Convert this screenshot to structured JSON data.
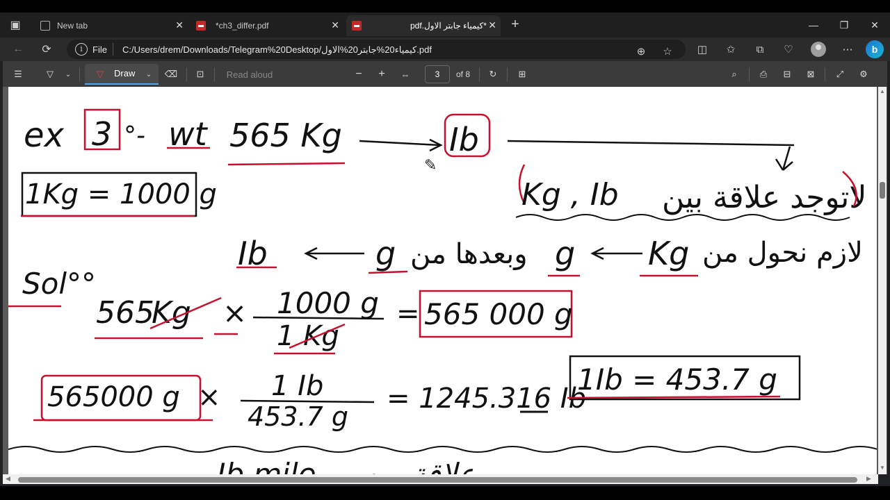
{
  "browser": {
    "tabs": [
      {
        "label": "New tab",
        "icon": "new-tab-icon"
      },
      {
        "label": "*ch3_differ.pdf",
        "icon": "pdf-icon"
      },
      {
        "label": "pdf.كيمياء جابتر الاول*",
        "icon": "pdf-icon",
        "active": true
      }
    ],
    "new_tab_symbol": "+",
    "window_controls": [
      "—",
      "❐",
      "✕"
    ],
    "address": {
      "prefix": "File",
      "url": "C:/Users/drem/Downloads/Telegram%20Desktop/كيمياء20%جابتر20%الاول.pdf"
    }
  },
  "pdf_toolbar": {
    "draw_label": "Draw",
    "read_aloud_label": "Read aloud",
    "current_page": "3",
    "page_of": "of 8"
  },
  "document": {
    "line1_ex": "ex",
    "line1_num": "3",
    "line1_colon": "°-",
    "line1_wt": "wt",
    "line1_mass": "565 Kg",
    "line1_target": "Ib",
    "conv_box": "1Kg = 1000 g",
    "arabic_note": "لاتوجد علاقة بين",
    "arabic_note_units": "Kg , Ib",
    "arabic_path": "لازم نحول من",
    "arabic_path_kg": "Kg",
    "arabic_path_g": "g",
    "arabic_path_then": "وبعدها من",
    "arabic_path_g2": "g",
    "arabic_path_ib": "Ib",
    "sol_label": "Sol°°",
    "step1_value": "565",
    "step1_unit": "Kg",
    "step1_times": "×",
    "step1_num": "1000 g",
    "step1_den": "1 Kg",
    "step1_eq": "=",
    "step1_result": "565 000 g",
    "step2_value": "565000 g",
    "step2_times": "×",
    "step2_num": "1 Ib",
    "step2_den": "453.7 g",
    "step2_result": "= 1245.316 Ib",
    "ib_box": "1Ib = 453.7 g",
    "next_line_partial": "Ib mile  ... علاقة بين"
  }
}
